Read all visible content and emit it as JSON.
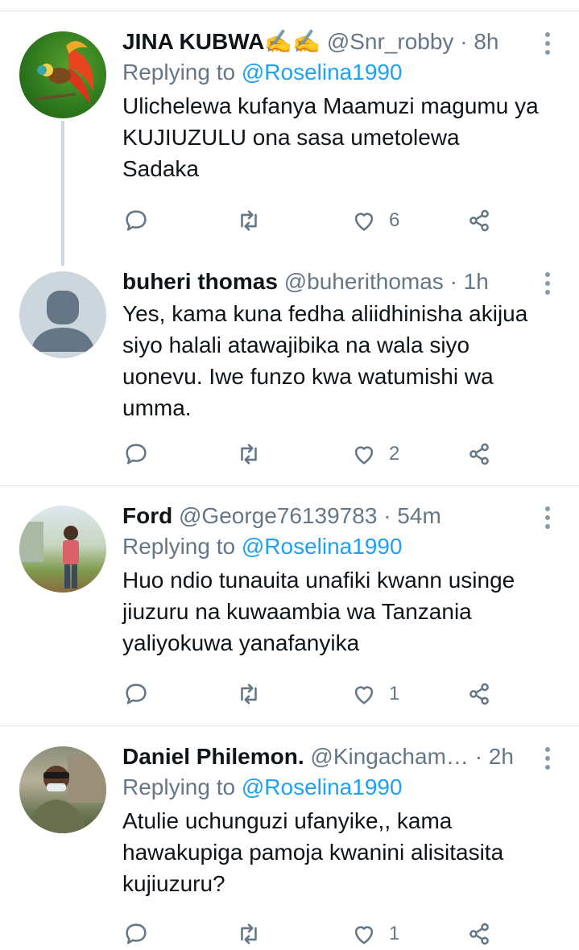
{
  "tweets": [
    {
      "name": "JINA KUBWA✍✍",
      "handle": "@Snr_robby",
      "time": "8h",
      "reply_prefix": "Replying to",
      "reply_to": "@Roselina1990",
      "text": "Ulichelewa kufanya Maamuzi magumu ya KUJIUZULU ona sasa umetolewa Sadaka",
      "likes": "6",
      "avatar": "bird-of-paradise"
    },
    {
      "name": "buheri thomas",
      "handle": "@buherithomas",
      "time": "1h",
      "text": "Yes, kama kuna fedha aliidhinisha akijua siyo halali atawajibika na wala siyo uonevu. Iwe funzo kwa watumishi wa umma.",
      "likes": "2",
      "avatar": "default-avatar"
    },
    {
      "name": "Ford",
      "handle": "@George76139783",
      "time": "54m",
      "reply_prefix": "Replying to",
      "reply_to": "@Roselina1990",
      "text": "Huo ndio tunauita unafiki kwann usinge jiuzuru na kuwaambia wa Tanzania yaliyokuwa yanafanyika",
      "likes": "1",
      "avatar": "man-outdoors-red-shirt"
    },
    {
      "name": "Daniel Philemon.",
      "handle": "@Kingacham…",
      "time": "2h",
      "reply_prefix": "Replying to",
      "reply_to": "@Roselina1990",
      "text": "Atulie uchunguzi ufanyike,, kama hawakupiga pamoja kwanini  alisitasita kujiuzuru?",
      "likes": "1",
      "avatar": "man-with-mask"
    }
  ],
  "separator": "·",
  "colors": {
    "link": "#1da1f2",
    "muted": "#657786",
    "divider": "#e1e6ea"
  }
}
